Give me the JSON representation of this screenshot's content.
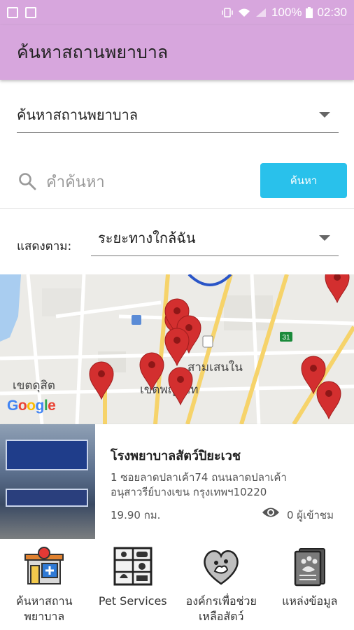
{
  "status_bar": {
    "battery": "100%",
    "time": "02:30"
  },
  "app_bar": {
    "title": "ค้นหาสถานพยาบาล"
  },
  "category_select": {
    "value": "ค้นหาสถานพยาบาล"
  },
  "search": {
    "placeholder": "คำค้นหา",
    "button_label": "ค้นหา"
  },
  "sort": {
    "label": "แสดงตาม:",
    "value": "ระยะทางใกล้ฉัน"
  },
  "map": {
    "labels": {
      "district1": "เขตดุสิต",
      "district2": "เขตพญาไท",
      "area": "สามเสนใน",
      "road_badge": "31"
    },
    "logo": "Google"
  },
  "result_card": {
    "name": "โรงพยาบาลสัตว์ปิยะเวช",
    "address_line1": "1 ซอยลาดปลาเค้า74 ถนนลาดปลาเค้า",
    "address_line2": "อนุสาวรีย์บางเขน   กรุงเทพฯ10220",
    "distance": "19.90 กม.",
    "views": "0 ผู้เข้าชม"
  },
  "bottom_nav": {
    "items": [
      {
        "label": "ค้นหาสถาน\nพยาบาล",
        "line1": "ค้นหาสถาน",
        "line2": "พยาบาล",
        "icon": "hospital-icon"
      },
      {
        "line1": "Pet Services",
        "line2": "",
        "icon": "pet-services-icon"
      },
      {
        "line1": "องค์กรเพื่อช่วย",
        "line2": "เหลือสัตว์",
        "icon": "heart-paw-icon"
      },
      {
        "line1": "แหล่งข้อมูล",
        "line2": "",
        "icon": "paw-document-icon"
      }
    ]
  },
  "colors": {
    "primary": "#d7a6dd",
    "accent": "#29c1eb",
    "marker": "#d32f2f"
  }
}
